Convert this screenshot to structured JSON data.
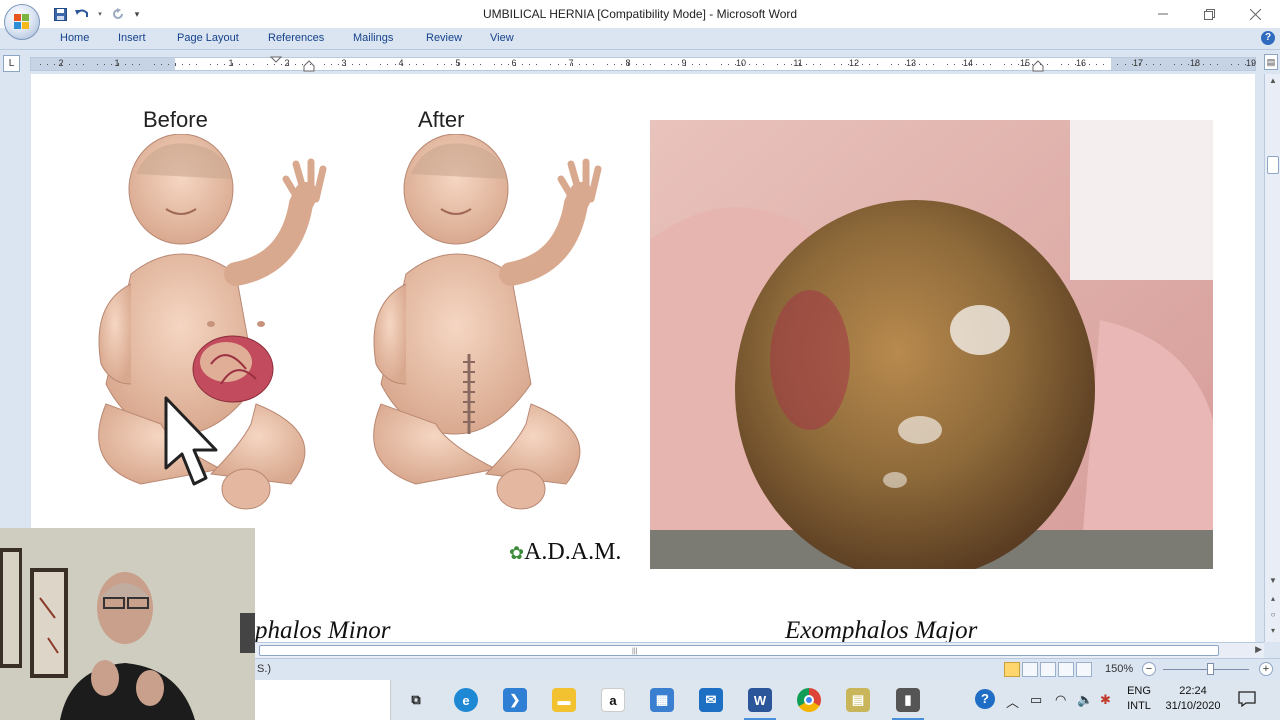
{
  "window": {
    "title": "UMBILICAL HERNIA [Compatibility Mode] - Microsoft Word",
    "minimize_icon": "minimize-icon",
    "maximize_icon": "restore-icon",
    "close_icon": "close-icon"
  },
  "ribbon": {
    "tabs": [
      "Home",
      "Insert",
      "Page Layout",
      "References",
      "Mailings",
      "Review",
      "View"
    ]
  },
  "ruler": {
    "numbers": [
      "2",
      "1",
      "1",
      "2",
      "3",
      "4",
      "5",
      "6",
      "7",
      "8",
      "9",
      "10",
      "11",
      "12",
      "13",
      "14",
      "15",
      "16",
      "17",
      "18",
      "19"
    ]
  },
  "document": {
    "figure_labels": {
      "before": "Before",
      "after": "After"
    },
    "adam_logo": "A.D.A.M.",
    "captions": {
      "left": "phalos Minor",
      "right": "Exomphalos Major"
    }
  },
  "statusbar": {
    "text": "S.)",
    "zoom": "150%"
  },
  "taskbar": {
    "apps": [
      "task-view",
      "edge",
      "visual-studio",
      "file-explorer",
      "amazon",
      "microsoft-store",
      "mail",
      "word",
      "chrome",
      "notes",
      "presenter"
    ],
    "language": {
      "line1": "ENG",
      "line2": "INTL"
    },
    "clock": {
      "time": "22:24",
      "date": "31/10/2020"
    }
  },
  "colors": {
    "ribbon_bg": "#dbe5f1",
    "tab_text": "#15428b",
    "page_bg": "#ffffff"
  }
}
